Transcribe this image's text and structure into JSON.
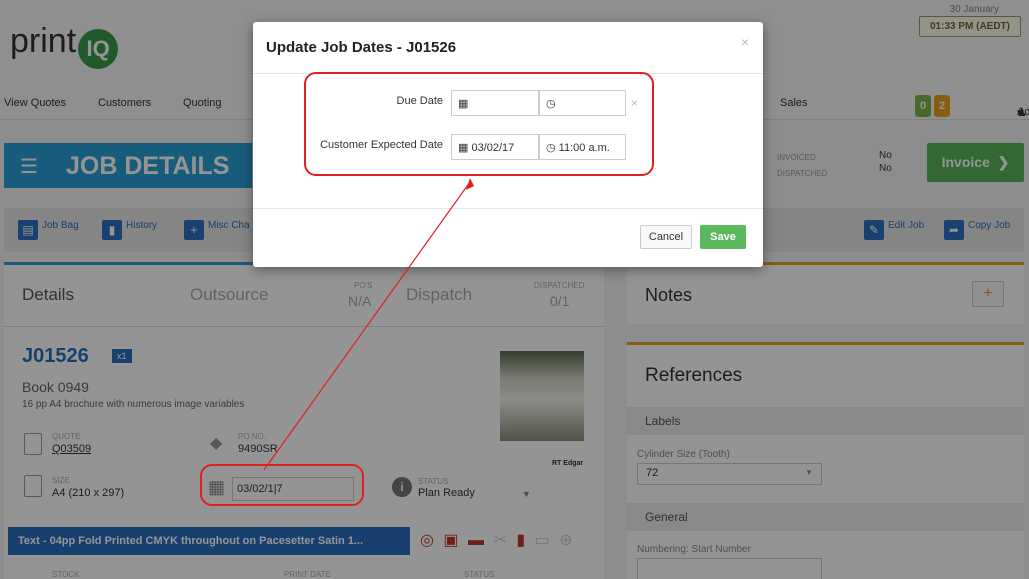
{
  "header": {
    "logo_text": "print",
    "logo_mark": "IQ",
    "date": "30 January",
    "time": "01:33 PM (AEDT)"
  },
  "nav": {
    "items": [
      "View Quotes",
      "Customers",
      "Quoting",
      "Sales"
    ],
    "badge_green": "0",
    "badge_orange": "2",
    "user": "Adater"
  },
  "job_header": {
    "title": "JOB DETAILS",
    "status_labels": [
      "INVOICED",
      "DISPATCHED"
    ],
    "status_values": [
      "No",
      "No"
    ],
    "invoice_button": "Invoice"
  },
  "toolbar": {
    "job_bag": "Job Bag",
    "history": "History",
    "misc": "Misc Cha",
    "edit_job": "Edit Job",
    "copy_job": "Copy Job"
  },
  "tabs": {
    "details": "Details",
    "outsource": "Outsource",
    "pos_label": "PO'S",
    "pos_value": "N/A",
    "dispatch": "Dispatch",
    "dispatched_label": "DISPATCHED",
    "dispatched_value": "0/1"
  },
  "job": {
    "id": "J01526",
    "qty_badge": "x1",
    "book": "Book 0949",
    "description": "16 pp A4 brochure with numerous image variables",
    "quote_label": "QUOTE",
    "quote_value": "Q03509",
    "po_label": "PO NO.",
    "po_value": "9490SR",
    "size_label": "SIZE",
    "size_value": "A4 (210 x 297)",
    "date_value": "03/02/1|7",
    "status_label": "STATUS",
    "status_value": "Plan Ready",
    "thumb_caption": "RT Edgar",
    "section_bar": "Text - 04pp Fold Printed CMYK throughout on Pacesetter Satin 1...",
    "stock_label": "STOCK",
    "print_date_label": "PRINT DATE",
    "status2_label": "STATUS"
  },
  "notes": {
    "title": "Notes",
    "add": "+"
  },
  "references": {
    "title": "References",
    "labels_section": "Labels",
    "cylinder_label": "Cylinder Size (Tooth)",
    "cylinder_value": "72",
    "general_section": "General",
    "numbering_label": "Numbering: Start Number"
  },
  "modal": {
    "title": "Update Job Dates - J01526",
    "close": "×",
    "due_date_label": "Due Date",
    "due_date_value": "",
    "due_time_value": "",
    "customer_date_label": "Customer Expected Date",
    "customer_date_value": "03/02/17",
    "customer_time_value": "11:00 a.m.",
    "clear": "×",
    "cancel": "Cancel",
    "save": "Save"
  }
}
